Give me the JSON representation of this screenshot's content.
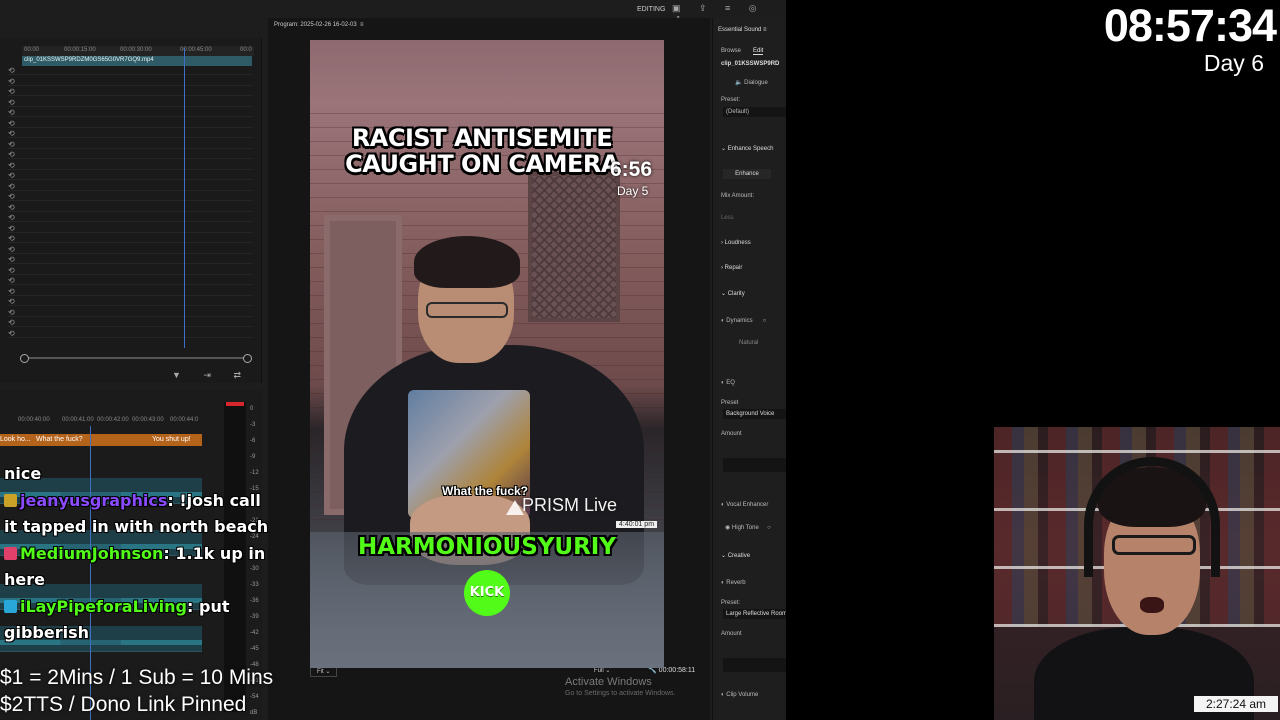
{
  "toolbar": {
    "mode": "EDITING",
    "icons": [
      "workspace-icon",
      "export-icon",
      "panel-menu-icon",
      "search-icon",
      "maximize-icon"
    ]
  },
  "source_panel": {
    "ruler_ticks": [
      "00:00",
      "00:00:15:00",
      "00:00:30:00",
      "00:00:45:00",
      "00:0"
    ],
    "clip_name": "clip_01KSSWSP9RDZM0GS65G0VR7GQ9.mp4",
    "rows": 26
  },
  "program": {
    "title": "Program: 2025-02-26 16-02-03",
    "fit": "Fit",
    "full": "Full",
    "timecode": "00:00:58:11"
  },
  "activate_windows": {
    "title": "Activate Windows",
    "subtitle": "Go to Settings to activate Windows."
  },
  "video": {
    "headline_1": "RACIST ANTISEMITE",
    "headline_2": "CAUGHT ON CAMERA",
    "timer": "6:56",
    "day": "Day 5",
    "caption": "What the fuck?",
    "prism": "PRISM Live",
    "prism_time": "4:40:01 pm",
    "username": "HARMONIOUSYURIY",
    "kick": "KICK"
  },
  "timeline": {
    "ruler_ticks": [
      "00:00:40:00",
      "00:00:41:00",
      "00:00:42:00",
      "00:00:43:00",
      "00:00:44:0"
    ],
    "captions": [
      "Look ho...",
      "What the fuck?",
      "You shut up!"
    ],
    "meter_ticks": [
      "0",
      "-3",
      "-6",
      "-9",
      "-12",
      "-15",
      "-18",
      "-21",
      "-24",
      "-27",
      "-30",
      "-33",
      "-36",
      "-39",
      "-42",
      "-45",
      "-48",
      "-51",
      "-54",
      "dB"
    ]
  },
  "essential_sound": {
    "title": "Essential Sound",
    "tab_browse": "Browse",
    "tab_edit": "Edit",
    "clip": "clip_01KSSWSP9RD",
    "dialogue": "Dialogue",
    "preset_label": "Preset:",
    "preset_value": "(Default)",
    "enhance_speech": "Enhance Speech",
    "enhance_button": "Enhance",
    "mix_amount": "Mix Amount:",
    "less": "Less",
    "loudness": "Loudness",
    "repair": "Repair",
    "clarity": "Clarity",
    "dynamics": "Dynamics",
    "natural": "Natural",
    "eq": "EQ",
    "preset": "Preset",
    "eq_preset": "Background Voice",
    "amount": "Amount",
    "vocal_enhancer": "Vocal Enhancer",
    "high_tone": "High Tone",
    "creative": "Creative",
    "reverb": "Reverb",
    "preset_colon": "Preset:",
    "reverb_preset": "Large Reflective Room",
    "clip_volume": "Clip Volume"
  },
  "overlay": {
    "clock": "08:57:34",
    "day": "Day 6",
    "line_1": "$1 = 2Mins / 1 Sub = 10 Mins",
    "line_2": "$2TTS / Dono Link Pinned",
    "webcam_time": "2:27:24 am"
  },
  "chat": [
    {
      "user": "",
      "message": "nice",
      "color": "#ffffff"
    },
    {
      "user": "jeanyusgraphics",
      "message": ": !josh call",
      "color": "#8a4bff"
    },
    {
      "user": "",
      "message": "it tapped in with north beach",
      "color": "#ffffff"
    },
    {
      "user": "MediumJohnson",
      "message": ": 1.1k up in",
      "color": "#53fc18"
    },
    {
      "user": "",
      "message": "here",
      "color": "#ffffff"
    },
    {
      "user": "iLayPipeforaLiving",
      "message": ": put",
      "color": "#53fc18"
    },
    {
      "user": "",
      "message": "gibberish",
      "color": "#ffffff"
    }
  ],
  "colors": {
    "kick_green": "#53fc18",
    "clip_orange": "#b4631b",
    "playhead_blue": "#3d6fc4"
  }
}
